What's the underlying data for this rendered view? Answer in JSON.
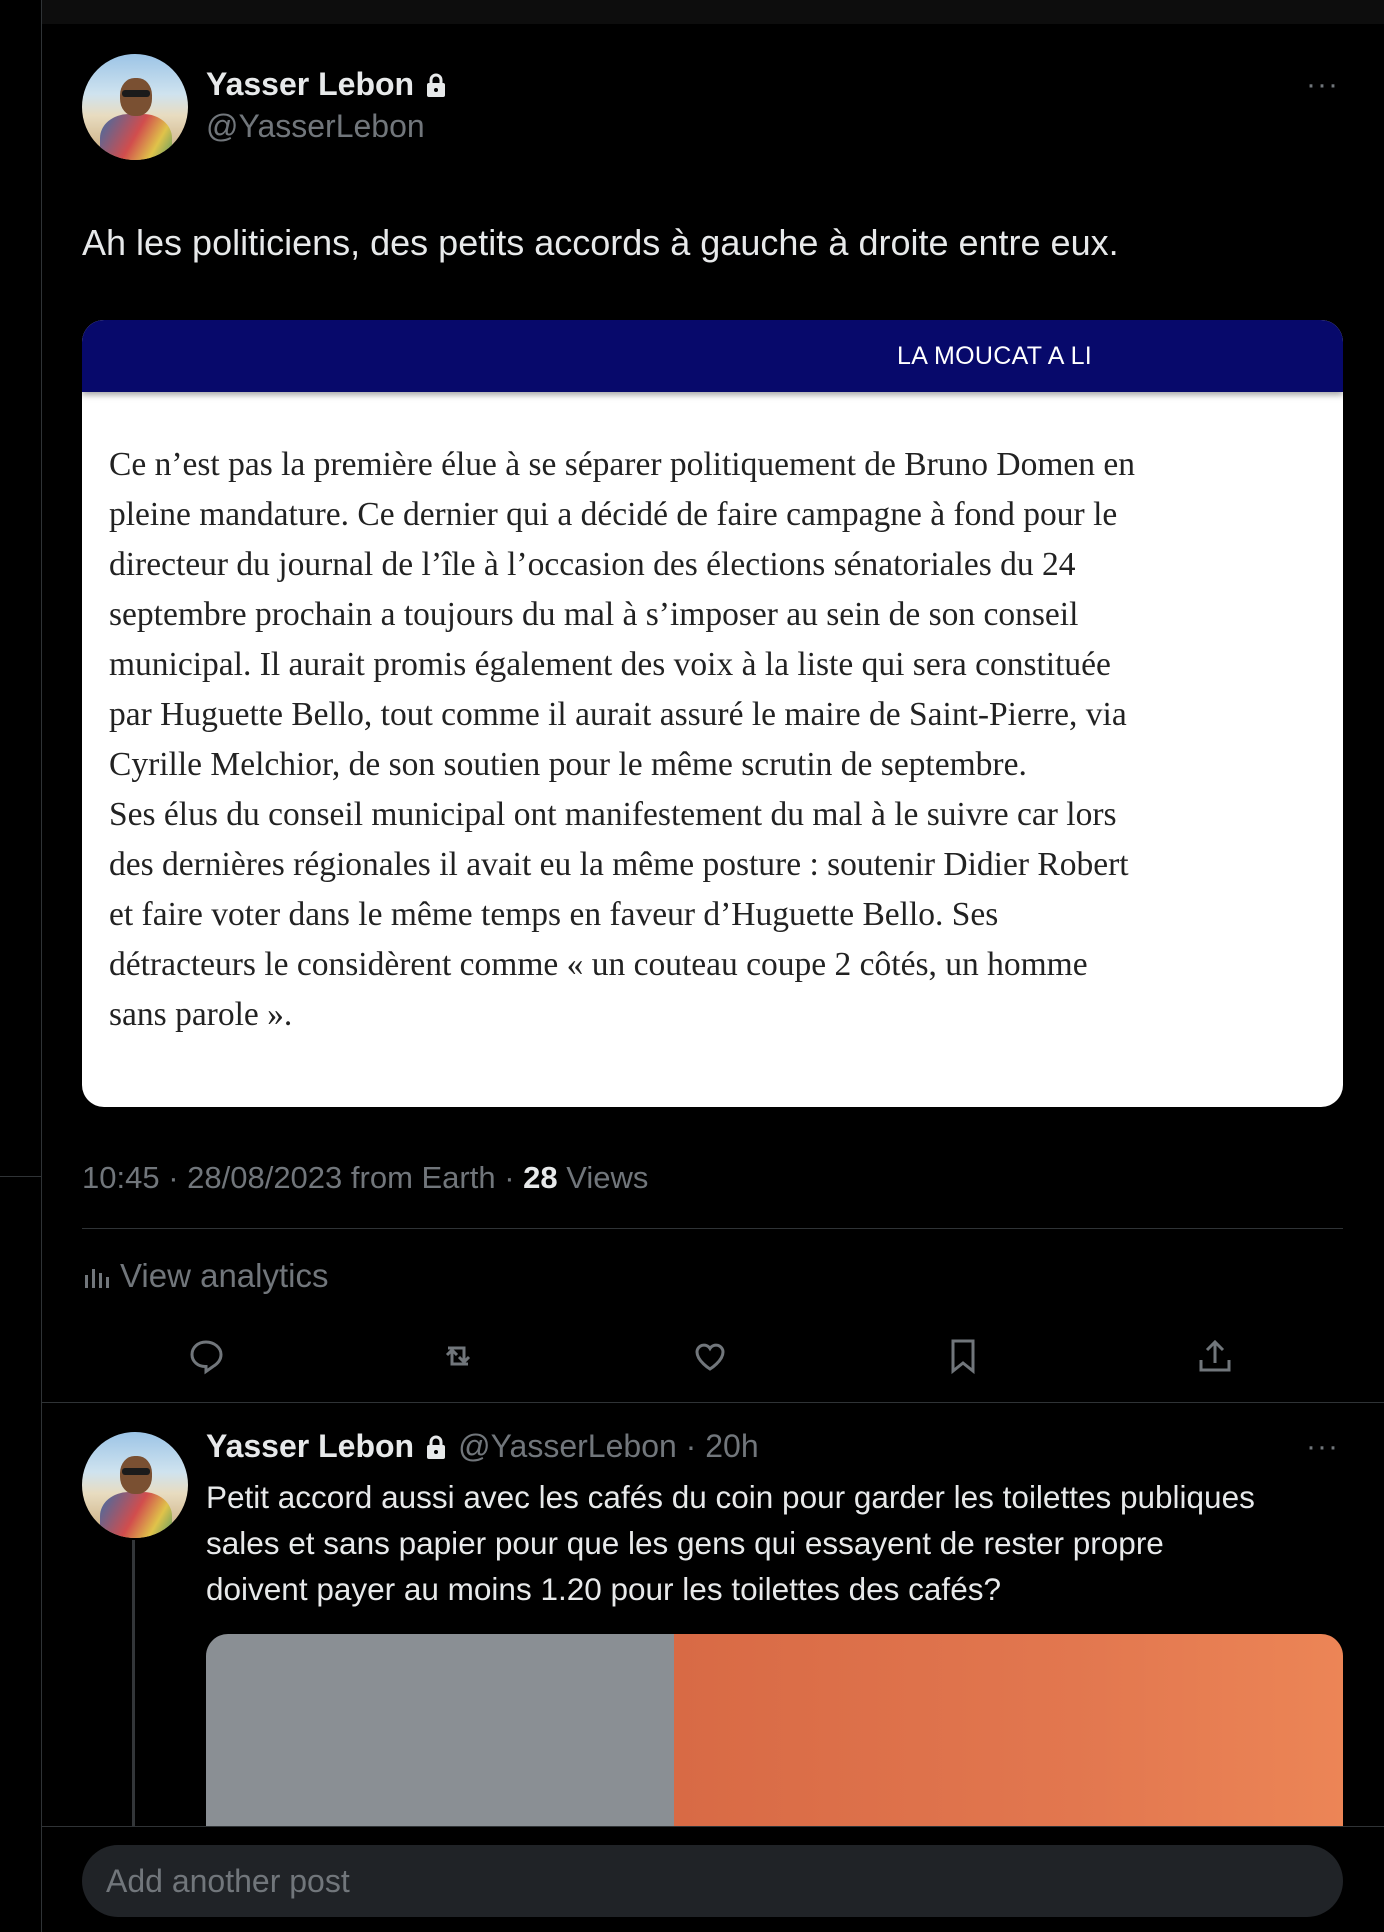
{
  "main_post": {
    "display_name": "Yasser Lebon",
    "handle": "@YasserLebon",
    "more": "···",
    "text": "Ah les politiciens, des petits accords à gauche à droite entre eux.",
    "quote": {
      "header": "LA MOUCAT A LI",
      "lines": [
        "Ce n’est pas la première élue à se séparer politiquement de Bruno Domen en",
        "pleine mandature. Ce dernier qui a décidé de faire campagne à fond pour le",
        "directeur du journal de l’île à l’occasion des élections sénatoriales du 24",
        "septembre prochain a toujours du mal à s’imposer au sein de son conseil",
        "municipal. Il aurait promis également des voix à la liste qui sera constituée",
        "par Huguette Bello, tout comme il aurait assuré le maire de Saint-Pierre, via",
        "Cyrille Melchior, de son soutien pour le même scrutin de septembre.",
        "Ses élus du conseil municipal ont manifestement du mal à le suivre car lors",
        "des dernières régionales il avait eu la même posture : soutenir Didier Robert",
        "et faire voter dans le même temps en faveur d’Huguette Bello. Ses",
        "détracteurs le considèrent comme « un couteau coupe 2 côtés, un homme",
        "sans parole »."
      ]
    },
    "meta": {
      "time_date": "10:45 · 28/08/2023 from Earth · ",
      "views_count": "28",
      "views_label": " Views"
    },
    "analytics_label": "View analytics",
    "actions": [
      "reply-icon",
      "repost-icon",
      "like-icon",
      "bookmark-icon",
      "share-icon"
    ]
  },
  "reply": {
    "display_name": "Yasser Lebon",
    "handle_time": "@YasserLebon · 20h",
    "more": "···",
    "lines": [
      "Petit accord aussi avec les cafés du coin pour garder les toilettes publiques",
      "sales et sans papier pour que les gens qui essayent de rester propre",
      "doivent payer au moins 1.20 pour les toilettes des cafés?"
    ]
  },
  "composer": {
    "placeholder": "Add another post"
  },
  "colors": {
    "background": "#000000",
    "text": "#e7e9ea",
    "muted": "#71767b",
    "quote_band": "#07096b"
  }
}
